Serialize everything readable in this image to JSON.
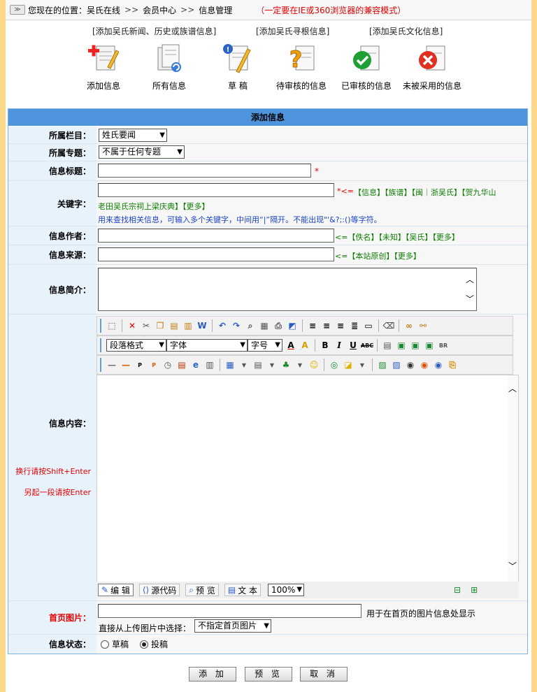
{
  "breadcrumb": {
    "prefix": "您现在的位置：",
    "items": [
      "吴氏在线",
      "会员中心",
      "信息管理"
    ],
    "separator": ">>",
    "warning": "（一定要在IE或360浏览器的兼容模式）"
  },
  "quick_links": [
    "[添加吴氏新闻、历史或族谱信息]",
    "[添加吴氏寻根信息]",
    "[添加吴氏文化信息]"
  ],
  "icons": [
    {
      "label": "添加信息",
      "icon": "add-document-icon"
    },
    {
      "label": "所有信息",
      "icon": "all-documents-icon"
    },
    {
      "label": "草 稿",
      "icon": "draft-icon"
    },
    {
      "label": "待审核的信息",
      "icon": "pending-icon"
    },
    {
      "label": "已审核的信息",
      "icon": "approved-icon"
    },
    {
      "label": "未被采用的信息",
      "icon": "rejected-icon"
    }
  ],
  "form": {
    "title": "添加信息",
    "column_label": "所属栏目：",
    "column_value": "姓氏要闻",
    "topic_label": "所属专题：",
    "topic_value": "不属于任何专题",
    "title_label": "信息标题：",
    "title_value": "",
    "required_mark": "*",
    "keywords_label": "关键字：",
    "keywords_value": "",
    "keywords_suggest_prefix": "*<=",
    "keywords_suggest_line1": "【信息】【族谱】【闽｜浙吴氏】【贺九华山",
    "keywords_suggest_line2": "老田吴氏宗祠上梁庆典】【更多】",
    "keywords_help": "用来查找相关信息，可输入多个关键字，中间用“|”隔开。不能出现\"'&?;:()等字符。",
    "author_label": "信息作者：",
    "author_value": "",
    "author_suggest": "<=【佚名】【未知】【吴氏】【更多】",
    "source_label": "信息来源：",
    "source_value": "",
    "source_suggest": "<=【本站原创】【更多】",
    "intro_label": "信息简介：",
    "intro_value": "",
    "content_label": "信息内容：",
    "content_hint1": "换行请按Shift+Enter",
    "content_hint2": "另起一段请按Enter",
    "editor": {
      "paragraph_format": "段落格式",
      "font": "字体",
      "font_size": "字号",
      "modes": [
        "编 辑",
        "源代码",
        "预 览",
        "文 本"
      ],
      "zoom": "100%"
    },
    "homepage_image_label": "首页图片：",
    "homepage_image_value": "",
    "homepage_image_note": "用于在首页的图片信息处显示",
    "upload_select_label": "直接从上传图片中选择：",
    "upload_select_value": "不指定首页图片",
    "status_label": "信息状态：",
    "status_options": [
      "草稿",
      "投稿"
    ],
    "status_selected": "投稿"
  },
  "buttons": {
    "add": "添 加",
    "preview": "预 览",
    "cancel": "取 消"
  },
  "colors": {
    "background": "#fbd88a",
    "header": "#4e95de",
    "label_bg": "#e8f2fb",
    "accent_red": "#e00000",
    "suggest_green": "#0c7d00"
  }
}
